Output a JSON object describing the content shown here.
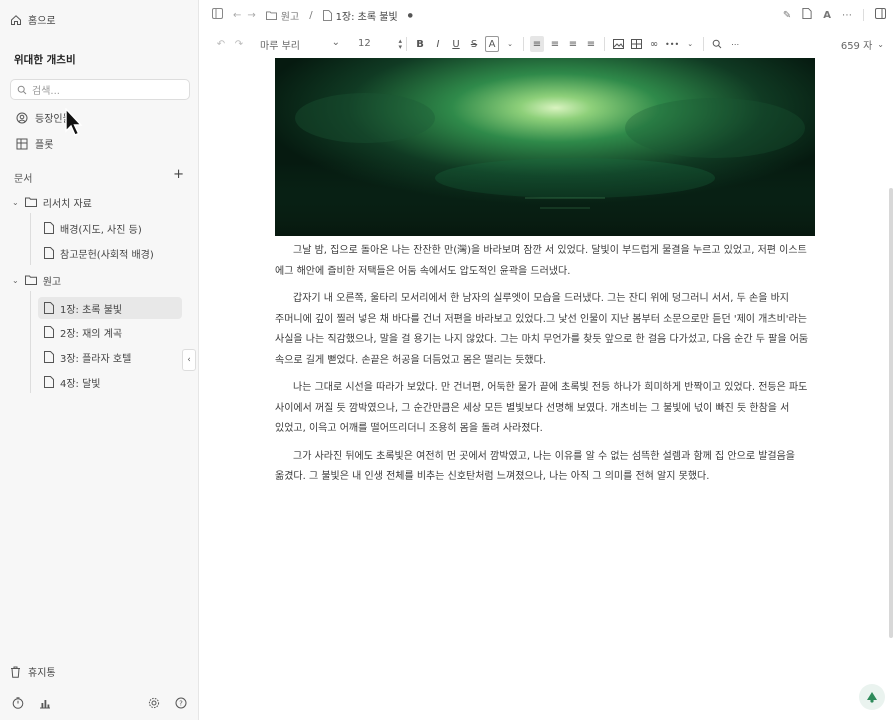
{
  "sidebar": {
    "home_label": "홈으로",
    "workspace_title": "위대한 개츠비",
    "search_placeholder": "검색...",
    "characters_label": "등장인물",
    "board_label": "플롯",
    "documents_label": "문서",
    "add_symbol": "+",
    "folders": [
      {
        "label": "리서치 자료",
        "items": [
          "배경(지도, 사진 등)",
          "참고문헌(사회적 배경)"
        ]
      },
      {
        "label": "원고",
        "items": [
          "1장: 초록 불빛",
          "2장: 재의 계곡",
          "3장: 플라자 호텔",
          "4장: 달빛"
        ]
      }
    ],
    "trash_label": "휴지통"
  },
  "topbar": {
    "breadcrumb_root": "원고",
    "breadcrumb_sep": "/",
    "document_title": "1장: 초록 불빛",
    "unsaved_dot": "●"
  },
  "toolbar": {
    "font_family": "마루 부리",
    "font_size": "12",
    "word_count": "659 자",
    "bold": "B",
    "italic": "I",
    "underline": "U",
    "strike": "S",
    "text_color": "A",
    "more": "•••"
  },
  "document": {
    "paragraphs": [
      "그날 밤, 집으로 돌아온 나는 잔잔한 만(灣)을 바라보며 잠깐 서 있었다. 달빛이 부드럽게 물결을 누르고 있었고, 저편 이스트 에그 해안에 즐비한 저택들은 어둠 속에서도 압도적인 윤곽을 드러냈다.",
      "갑자기 내 오른쪽, 울타리 모서리에서 한 남자의 실루엣이 모습을 드러냈다. 그는 잔디 위에 덩그러니 서서, 두 손을 바지 주머니에 깊이 찔러 넣은 채 바다를 건너 저편을 바라보고 있었다.그 낯선 인물이 지난 봄부터 소문으로만 듣던 '제이 개츠비'라는 사실을 나는 직감했으나, 말을 걸 용기는 나지 않았다. 그는 마치 무언가를 찾듯 앞으로 한 걸음 다가섰고, 다음 순간 두 팔을 어둠 속으로 길게 뻗었다. 손끝은 허공을 더듬었고 몸은 떨리는 듯했다.",
      "나는 그대로 시선을 따라가 보았다. 만 건너편, 어둑한 물가 끝에 초록빛 전등 하나가 희미하게 반짝이고 있었다. 전등은 파도 사이에서 꺼질 듯 깜박였으나, 그 순간만큼은 세상 모든 별빛보다 선명해 보였다. 개츠비는 그 불빛에 넋이 빠진 듯 한참을 서 있었고, 이윽고 어깨를 떨어뜨리더니 조용히 몸을 돌려 사라졌다.",
      "그가 사라진 뒤에도 초록빛은 여전히 먼 곳에서 깜박였고, 나는 이유를 알 수 없는 섬뜩한 설렘과 함께 집 안으로 발걸음을 옮겼다. 그 불빛은 내 인생 전체를 비추는 신호탄처럼 느껴졌으나, 나는 아직 그 의미를 전혀 알지 못했다."
    ]
  },
  "colors": {
    "accent_green": "#1f6b45",
    "sidebar_bg": "#f7f7f7"
  }
}
